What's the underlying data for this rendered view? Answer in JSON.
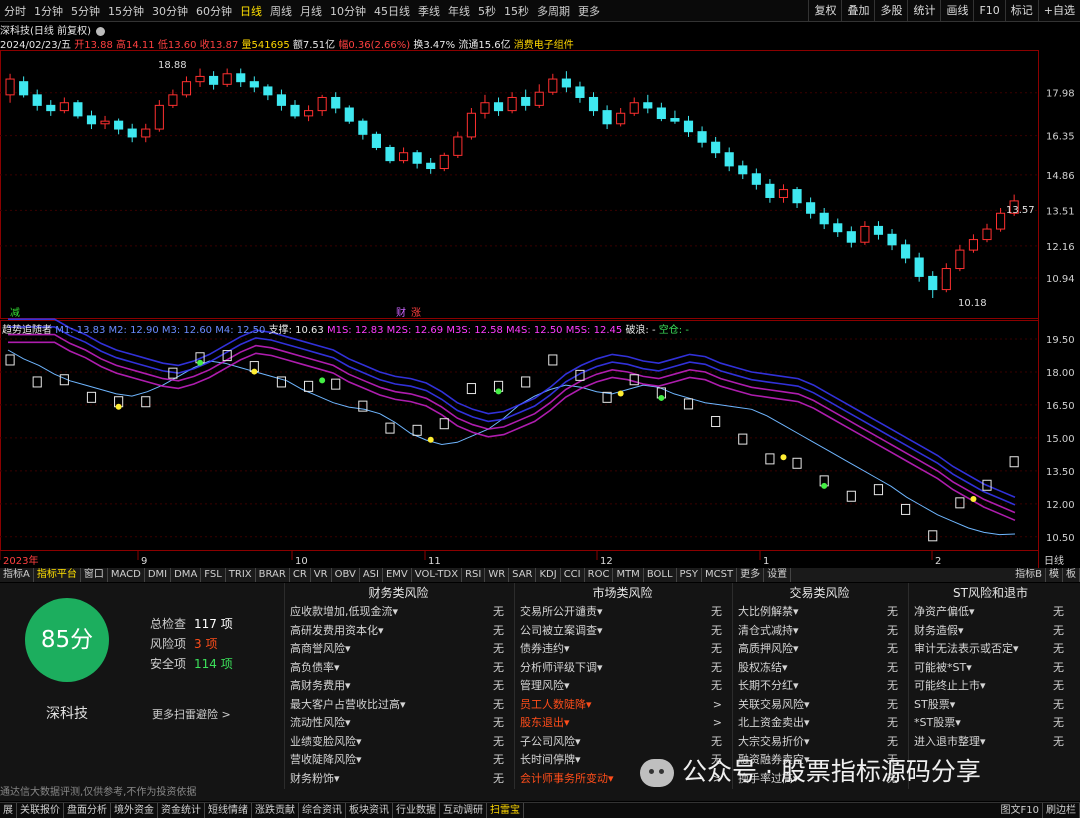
{
  "toolbar": {
    "periods": [
      "分时",
      "1分钟",
      "5分钟",
      "15分钟",
      "30分钟",
      "60分钟",
      "日线",
      "周线",
      "月线",
      "10分钟",
      "45日线",
      "季线",
      "年线",
      "5秒",
      "15秒",
      "多周期",
      "更多"
    ],
    "active_period_index": 6,
    "right_buttons": [
      "复权",
      "叠加",
      "多股",
      "统计",
      "画线",
      "F10",
      "标记",
      "+自选"
    ]
  },
  "info": {
    "title": "深科技(日线 前复权)",
    "date": "2024/02/23/五",
    "open": "开13.88",
    "high": "高14.11",
    "low": "低13.60",
    "close": "收13.87",
    "volume": "量541695",
    "amount": "额7.51亿",
    "change": "幅0.36(2.66%)",
    "turnover": "换3.47%",
    "float": "流通15.6亿",
    "sector": "消费电子组件"
  },
  "price_axis": [
    "17.98",
    "16.35",
    "14.86",
    "13.51",
    "12.16",
    "10.94"
  ],
  "price_labels": {
    "high_marker": "18.88",
    "low_marker": "10.18",
    "last": "13.57"
  },
  "main_pane": {
    "markers": [
      "减",
      "财",
      "涨"
    ]
  },
  "indicator": {
    "name": "趋势追随者",
    "values": "M1: 13.83  M2: 12.90  M3: 12.60  M4: 12.50",
    "support": "支撑: 10.63",
    "ms_values": "M1S: 12.83  M2S: 12.69  M3S: 12.58  M4S: 12.50  M5S: 12.45",
    "breakout": "破浪: -",
    "empty_pos": "空仓: -",
    "axis": [
      "19.50",
      "18.00",
      "16.50",
      "15.00",
      "13.50",
      "12.00",
      "10.50"
    ]
  },
  "time_axis": [
    "2023年",
    "9",
    "10",
    "11",
    "12",
    "1",
    "2"
  ],
  "time_axis_right": "日线",
  "indicator_tabs": [
    "指标A",
    "指标平台",
    "窗口",
    "MACD",
    "DMI",
    "DMA",
    "FSL",
    "TRIX",
    "BRAR",
    "CR",
    "VR",
    "OBV",
    "ASI",
    "EMV",
    "VOL-TDX",
    "RSI",
    "WR",
    "SAR",
    "KDJ",
    "CCI",
    "ROC",
    "MTM",
    "BOLL",
    "PSY",
    "MCST",
    "更多",
    "设置"
  ],
  "indicator_tabs_active": 1,
  "indicator_tabs_right": [
    "指标B",
    "模",
    "板"
  ],
  "scan": {
    "score": "85分",
    "stock": "深科技",
    "total_label": "总检查",
    "total_value": "117 项",
    "risk_label": "风险项",
    "risk_value": "3 项",
    "safe_label": "安全项",
    "safe_value": "114 项",
    "more": "更多扫雷避险 >",
    "disclaimer": "通达信大数据评测,仅供参考,不作为投资依据",
    "colors": {
      "score_bg": "#1cae5e",
      "risk": "#ff4d1a",
      "safe": "#3ce05a"
    },
    "columns": [
      {
        "title": "财务类风险",
        "items": [
          {
            "label": "应收款增加,低现金流",
            "status": "无"
          },
          {
            "label": "高研发费用资本化",
            "status": "无"
          },
          {
            "label": "高商誉风险",
            "status": "无"
          },
          {
            "label": "高负债率",
            "status": "无"
          },
          {
            "label": "高财务费用",
            "status": "无"
          },
          {
            "label": "最大客户占营收比过高",
            "status": "无"
          },
          {
            "label": "流动性风险",
            "status": "无"
          },
          {
            "label": "业绩变脸风险",
            "status": "无"
          },
          {
            "label": "营收陡降风险",
            "status": "无"
          },
          {
            "label": "财务粉饰",
            "status": "无"
          }
        ]
      },
      {
        "title": "市场类风险",
        "items": [
          {
            "label": "交易所公开谴责",
            "status": "无"
          },
          {
            "label": "公司被立案调查",
            "status": "无"
          },
          {
            "label": "债券违约",
            "status": "无"
          },
          {
            "label": "分析师评级下调",
            "status": "无"
          },
          {
            "label": "管理风险",
            "status": "无"
          },
          {
            "label": "员工人数陡降",
            "status": ">",
            "alert": true
          },
          {
            "label": "股东退出",
            "status": ">",
            "alert": true
          },
          {
            "label": "子公司风险",
            "status": "无"
          },
          {
            "label": "长时间停牌",
            "status": "无"
          },
          {
            "label": "会计师事务所变动",
            "status": ">",
            "alert": true
          }
        ]
      },
      {
        "title": "交易类风险",
        "items": [
          {
            "label": "大比例解禁",
            "status": "无"
          },
          {
            "label": "清仓式减持",
            "status": "无"
          },
          {
            "label": "高质押风险",
            "status": "无"
          },
          {
            "label": "股权冻结",
            "status": "无"
          },
          {
            "label": "长期不分红",
            "status": "无"
          },
          {
            "label": "关联交易风险",
            "status": "无"
          },
          {
            "label": "北上资金卖出",
            "status": "无"
          },
          {
            "label": "大宗交易折价",
            "status": "无"
          },
          {
            "label": "融资融券卖空",
            "status": "无"
          },
          {
            "label": "换手率过高",
            "status": "无"
          }
        ]
      },
      {
        "title": "ST风险和退市",
        "items": [
          {
            "label": "净资产偏低",
            "status": "无"
          },
          {
            "label": "财务造假",
            "status": "无"
          },
          {
            "label": "审计无法表示或否定",
            "status": "无"
          },
          {
            "label": "可能被*ST",
            "status": "无"
          },
          {
            "label": "可能终止上市",
            "status": "无"
          },
          {
            "label": "ST股票",
            "status": "无"
          },
          {
            "label": "*ST股票",
            "status": "无"
          },
          {
            "label": "进入退市整理",
            "status": "无"
          }
        ]
      }
    ]
  },
  "bottom_tabs": [
    "展",
    "关联报价",
    "盘面分析",
    "境外资金",
    "资金统计",
    "短线情绪",
    "涨跌贡献",
    "综合资讯",
    "板块资讯",
    "行业数据",
    "互动调研",
    "扫雷宝"
  ],
  "bottom_tabs_active": 11,
  "bottom_right": [
    "图文F10",
    "刷边栏"
  ],
  "watermark": "公众号 · 股票指标源码分享",
  "chart_data": {
    "type": "candlestick",
    "y_range_price": [
      9.8,
      19.3
    ],
    "y_range_indicator": [
      9.9,
      20.0
    ],
    "candles": [
      [
        17.9,
        18.5,
        18.7,
        17.6
      ],
      [
        18.4,
        17.9,
        18.6,
        17.8
      ],
      [
        17.9,
        17.5,
        18.1,
        17.3
      ],
      [
        17.5,
        17.3,
        17.7,
        17.1
      ],
      [
        17.3,
        17.6,
        17.8,
        17.2
      ],
      [
        17.6,
        17.1,
        17.7,
        17.0
      ],
      [
        17.1,
        16.8,
        17.3,
        16.6
      ],
      [
        16.8,
        16.9,
        17.1,
        16.6
      ],
      [
        16.9,
        16.6,
        17.0,
        16.4
      ],
      [
        16.6,
        16.3,
        16.8,
        16.1
      ],
      [
        16.3,
        16.6,
        16.8,
        16.1
      ],
      [
        16.6,
        17.5,
        17.7,
        16.5
      ],
      [
        17.5,
        17.9,
        18.1,
        17.4
      ],
      [
        17.9,
        18.4,
        18.6,
        17.8
      ],
      [
        18.4,
        18.6,
        18.9,
        18.2
      ],
      [
        18.6,
        18.3,
        18.8,
        18.1
      ],
      [
        18.3,
        18.7,
        18.9,
        18.2
      ],
      [
        18.7,
        18.4,
        18.9,
        18.2
      ],
      [
        18.4,
        18.2,
        18.6,
        18.0
      ],
      [
        18.2,
        17.9,
        18.3,
        17.7
      ],
      [
        17.9,
        17.5,
        18.1,
        17.3
      ],
      [
        17.5,
        17.1,
        17.7,
        17.0
      ],
      [
        17.1,
        17.3,
        17.5,
        16.9
      ],
      [
        17.3,
        17.8,
        17.9,
        17.1
      ],
      [
        17.8,
        17.4,
        18.0,
        17.2
      ],
      [
        17.4,
        16.9,
        17.5,
        16.8
      ],
      [
        16.9,
        16.4,
        17.0,
        16.2
      ],
      [
        16.4,
        15.9,
        16.5,
        15.8
      ],
      [
        15.9,
        15.4,
        16.0,
        15.3
      ],
      [
        15.4,
        15.7,
        15.9,
        15.3
      ],
      [
        15.7,
        15.3,
        15.8,
        15.1
      ],
      [
        15.3,
        15.1,
        15.5,
        14.9
      ],
      [
        15.1,
        15.6,
        15.7,
        15.0
      ],
      [
        15.6,
        16.3,
        16.5,
        15.5
      ],
      [
        16.3,
        17.2,
        17.4,
        16.2
      ],
      [
        17.2,
        17.6,
        17.9,
        17.0
      ],
      [
        17.6,
        17.3,
        17.8,
        17.1
      ],
      [
        17.3,
        17.8,
        18.0,
        17.2
      ],
      [
        17.8,
        17.5,
        18.1,
        17.3
      ],
      [
        17.5,
        18.0,
        18.3,
        17.4
      ],
      [
        18.0,
        18.5,
        18.7,
        17.9
      ],
      [
        18.5,
        18.2,
        18.8,
        18.0
      ],
      [
        18.2,
        17.8,
        18.4,
        17.6
      ],
      [
        17.8,
        17.3,
        18.0,
        17.1
      ],
      [
        17.3,
        16.8,
        17.5,
        16.6
      ],
      [
        16.8,
        17.2,
        17.4,
        16.7
      ],
      [
        17.2,
        17.6,
        17.8,
        17.1
      ],
      [
        17.6,
        17.4,
        17.9,
        17.2
      ],
      [
        17.4,
        17.0,
        17.6,
        16.9
      ],
      [
        17.0,
        16.9,
        17.3,
        16.8
      ],
      [
        16.9,
        16.5,
        17.1,
        16.3
      ],
      [
        16.5,
        16.1,
        16.7,
        15.9
      ],
      [
        16.1,
        15.7,
        16.3,
        15.5
      ],
      [
        15.7,
        15.2,
        15.9,
        15.0
      ],
      [
        15.2,
        14.9,
        15.4,
        14.7
      ],
      [
        14.9,
        14.5,
        15.1,
        14.3
      ],
      [
        14.5,
        14.0,
        14.7,
        13.8
      ],
      [
        14.0,
        14.3,
        14.5,
        13.8
      ],
      [
        14.3,
        13.8,
        14.4,
        13.6
      ],
      [
        13.8,
        13.4,
        14.0,
        13.2
      ],
      [
        13.4,
        13.0,
        13.6,
        12.8
      ],
      [
        13.0,
        12.7,
        13.2,
        12.5
      ],
      [
        12.7,
        12.3,
        12.9,
        12.1
      ],
      [
        12.3,
        12.9,
        13.1,
        12.2
      ],
      [
        12.9,
        12.6,
        13.1,
        12.4
      ],
      [
        12.6,
        12.2,
        12.8,
        12.0
      ],
      [
        12.2,
        11.7,
        12.4,
        11.5
      ],
      [
        11.7,
        11.0,
        11.9,
        10.8
      ],
      [
        11.0,
        10.5,
        11.2,
        10.18
      ],
      [
        10.5,
        11.3,
        11.5,
        10.4
      ],
      [
        11.3,
        12.0,
        12.2,
        11.2
      ],
      [
        12.0,
        12.4,
        12.6,
        11.9
      ],
      [
        12.4,
        12.8,
        13.0,
        12.3
      ],
      [
        12.8,
        13.4,
        13.6,
        12.7
      ],
      [
        13.4,
        13.87,
        14.11,
        13.3
      ]
    ],
    "indicator_close": [
      19.0,
      18.6,
      18.3,
      17.9,
      17.6,
      17.4,
      17.2,
      17.0,
      16.9,
      17.1,
      17.4,
      17.8,
      18.2,
      18.5,
      18.4,
      18.2,
      18.0,
      17.8,
      17.6,
      17.2,
      16.9,
      16.6,
      16.4,
      16.3,
      16.1,
      15.7,
      15.2,
      14.9,
      14.7,
      14.8,
      15.1,
      15.4,
      15.9,
      16.5,
      16.9,
      17.2,
      17.4,
      17.3,
      17.1,
      17.0,
      17.2,
      17.4,
      17.3,
      17.0,
      16.8,
      16.6,
      16.5,
      16.4,
      16.3,
      16.0,
      15.6,
      15.2,
      14.8,
      14.4,
      14.0,
      13.6,
      13.2,
      12.8,
      12.3,
      11.9,
      11.5,
      11.2,
      10.9,
      10.7,
      10.6,
      10.63
    ]
  }
}
